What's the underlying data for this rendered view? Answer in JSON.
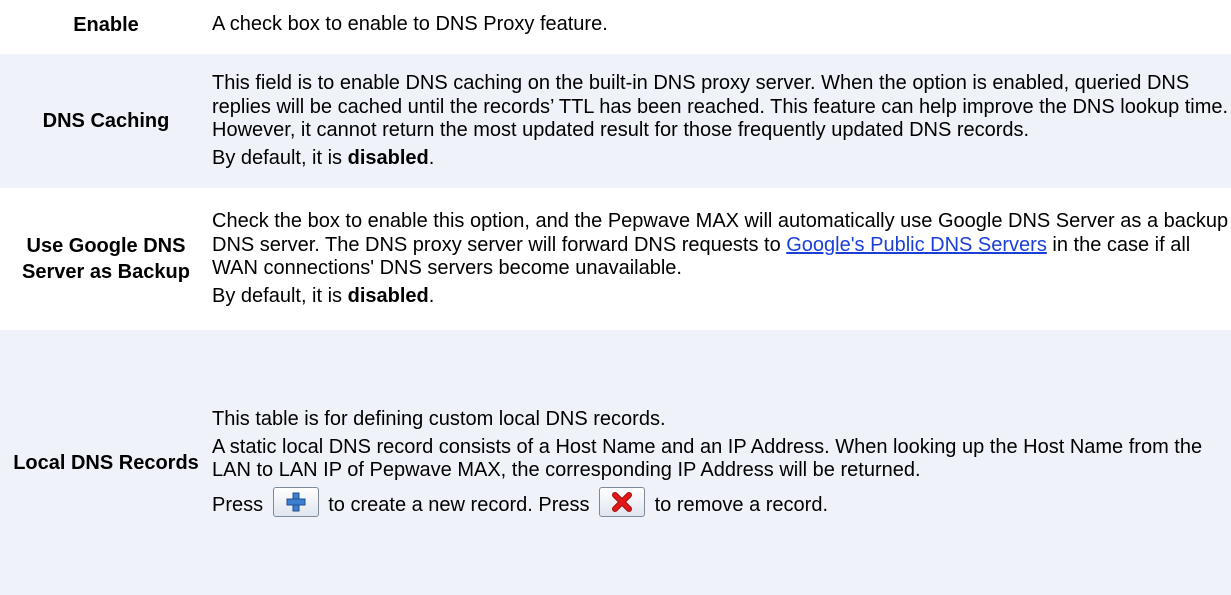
{
  "rows": [
    {
      "term": "Enable",
      "desc": [
        "A check box to enable to DNS Proxy feature."
      ]
    },
    {
      "term": "DNS Caching",
      "desc": [
        "This field is to enable DNS caching on the built-in DNS proxy server.   When the option is enabled, queried DNS replies will be cached until the records’ TTL has been reached.  This feature can help improve the DNS lookup time.  However, it cannot return the most updated result for those frequently updated DNS records."
      ],
      "default_prefix": "By default, it is ",
      "default_value": "disabled",
      "default_suffix": "."
    },
    {
      "term": "Use Google DNS Server as Backup",
      "desc_before_link": "Check the box to enable this option, and the Pepwave MAX will automatically use Google DNS Server as a backup DNS server. The DNS proxy server will forward DNS requests to ",
      "link": "Google's Public DNS Servers",
      "desc_after_link": " in the case if all WAN connections' DNS servers become unavailable.",
      "default_prefix": "By default, it is ",
      "default_value": "disabled",
      "default_suffix": "."
    },
    {
      "term": "Local DNS Records",
      "desc": [
        "This table is for defining custom local DNS records.",
        "A static local DNS record consists of a Host Name and an IP Address.  When looking up the Host Name from the LAN to LAN IP of Pepwave MAX, the corresponding IP Address will be returned."
      ],
      "press_1": "Press ",
      "press_2": " to create a new record. Press ",
      "press_3": " to remove a record."
    }
  ],
  "colors": {
    "row_shade": "#eff2f8",
    "link": "#1a3fd8",
    "add_icon": "#3c7fd0",
    "remove_icon": "#e01818"
  },
  "icons": {
    "add": "add-record-icon",
    "remove": "remove-record-icon"
  }
}
